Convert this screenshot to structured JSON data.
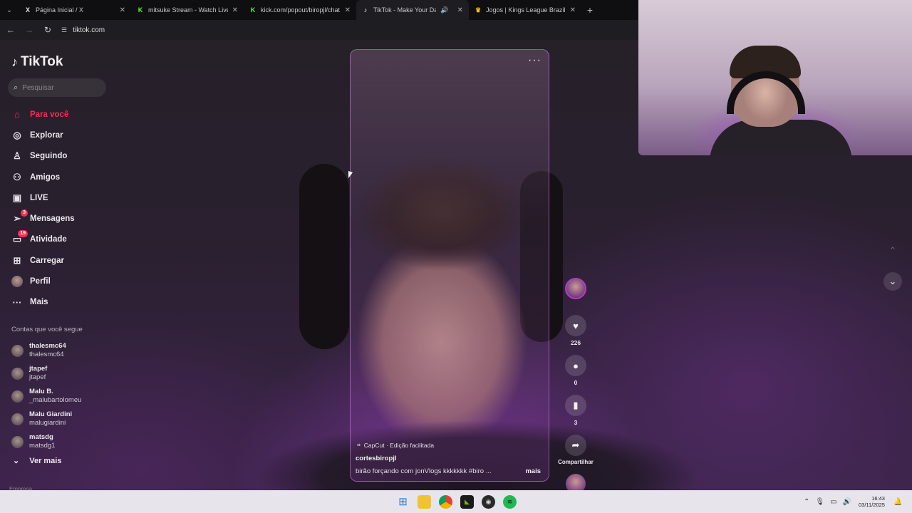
{
  "browser": {
    "tabs": [
      {
        "favicon": "X",
        "favicon_color": "#e7e7e7",
        "title": "Página Inicial / X",
        "active": false
      },
      {
        "favicon": "K",
        "favicon_color": "#53fc18",
        "title": "mitsuke Stream - Watch Live on Kick",
        "active": false
      },
      {
        "favicon": "K",
        "favicon_color": "#53fc18",
        "title": "kick.com/popout/biropjl/chat",
        "active": false
      },
      {
        "favicon": "♪",
        "favicon_color": "#ffffff",
        "title": "TikTok - Make Your Day",
        "active": true,
        "audio": true
      },
      {
        "favicon": "♛",
        "favicon_color": "#f4c20d",
        "title": "Jogos | Kings League Brazil",
        "active": false
      }
    ],
    "url": "tiktok.com"
  },
  "sidebar": {
    "logo_text": "TikTok",
    "search_placeholder": "Pesquisar",
    "nav": [
      {
        "label": "Para você",
        "icon": "home-icon",
        "glyph": "⌂",
        "active": true
      },
      {
        "label": "Explorar",
        "icon": "compass-icon",
        "glyph": "◎",
        "active": false
      },
      {
        "label": "Seguindo",
        "icon": "following-icon",
        "glyph": "♙",
        "active": false
      },
      {
        "label": "Amigos",
        "icon": "friends-icon",
        "glyph": "⚇",
        "active": false
      },
      {
        "label": "LIVE",
        "icon": "live-icon",
        "glyph": "▣",
        "active": false
      },
      {
        "label": "Mensagens",
        "icon": "messages-icon",
        "glyph": "➢",
        "badge": "3",
        "active": false
      },
      {
        "label": "Atividade",
        "icon": "activity-icon",
        "glyph": "▭",
        "badge": "19",
        "active": false
      },
      {
        "label": "Carregar",
        "icon": "upload-icon",
        "glyph": "⊞",
        "active": false
      },
      {
        "label": "Perfil",
        "icon": "profile-avatar-icon",
        "glyph": "",
        "active": false
      },
      {
        "label": "Mais",
        "icon": "more-icon",
        "glyph": "···",
        "active": false
      }
    ],
    "following_title": "Contas que você segue",
    "following": [
      {
        "name": "thalesmc64",
        "handle": "thalesmc64"
      },
      {
        "name": "jtapef",
        "handle": "jtapef"
      },
      {
        "name": "Malu B.",
        "handle": "_malubartolomeu"
      },
      {
        "name": "Malu Giardini",
        "handle": "malugiardini"
      },
      {
        "name": "matsdg",
        "handle": "matsdg1"
      }
    ],
    "see_more": "Ver mais",
    "footer": "Empresa"
  },
  "video": {
    "capcut_text": "CapCut · Edição facilitada",
    "author": "cortesbiropjl",
    "caption": "birão forçando com jonVlogs kkkkkkk #biro ...",
    "more_label": "mais"
  },
  "actions": {
    "likes": "226",
    "comments": "0",
    "saves": "3",
    "share_label": "Compartilhar"
  },
  "taskbar": {
    "time": "16:43",
    "date": "03/11/2025"
  },
  "colors": {
    "accent": "#fe2c55",
    "video_border": "#e678ff"
  }
}
